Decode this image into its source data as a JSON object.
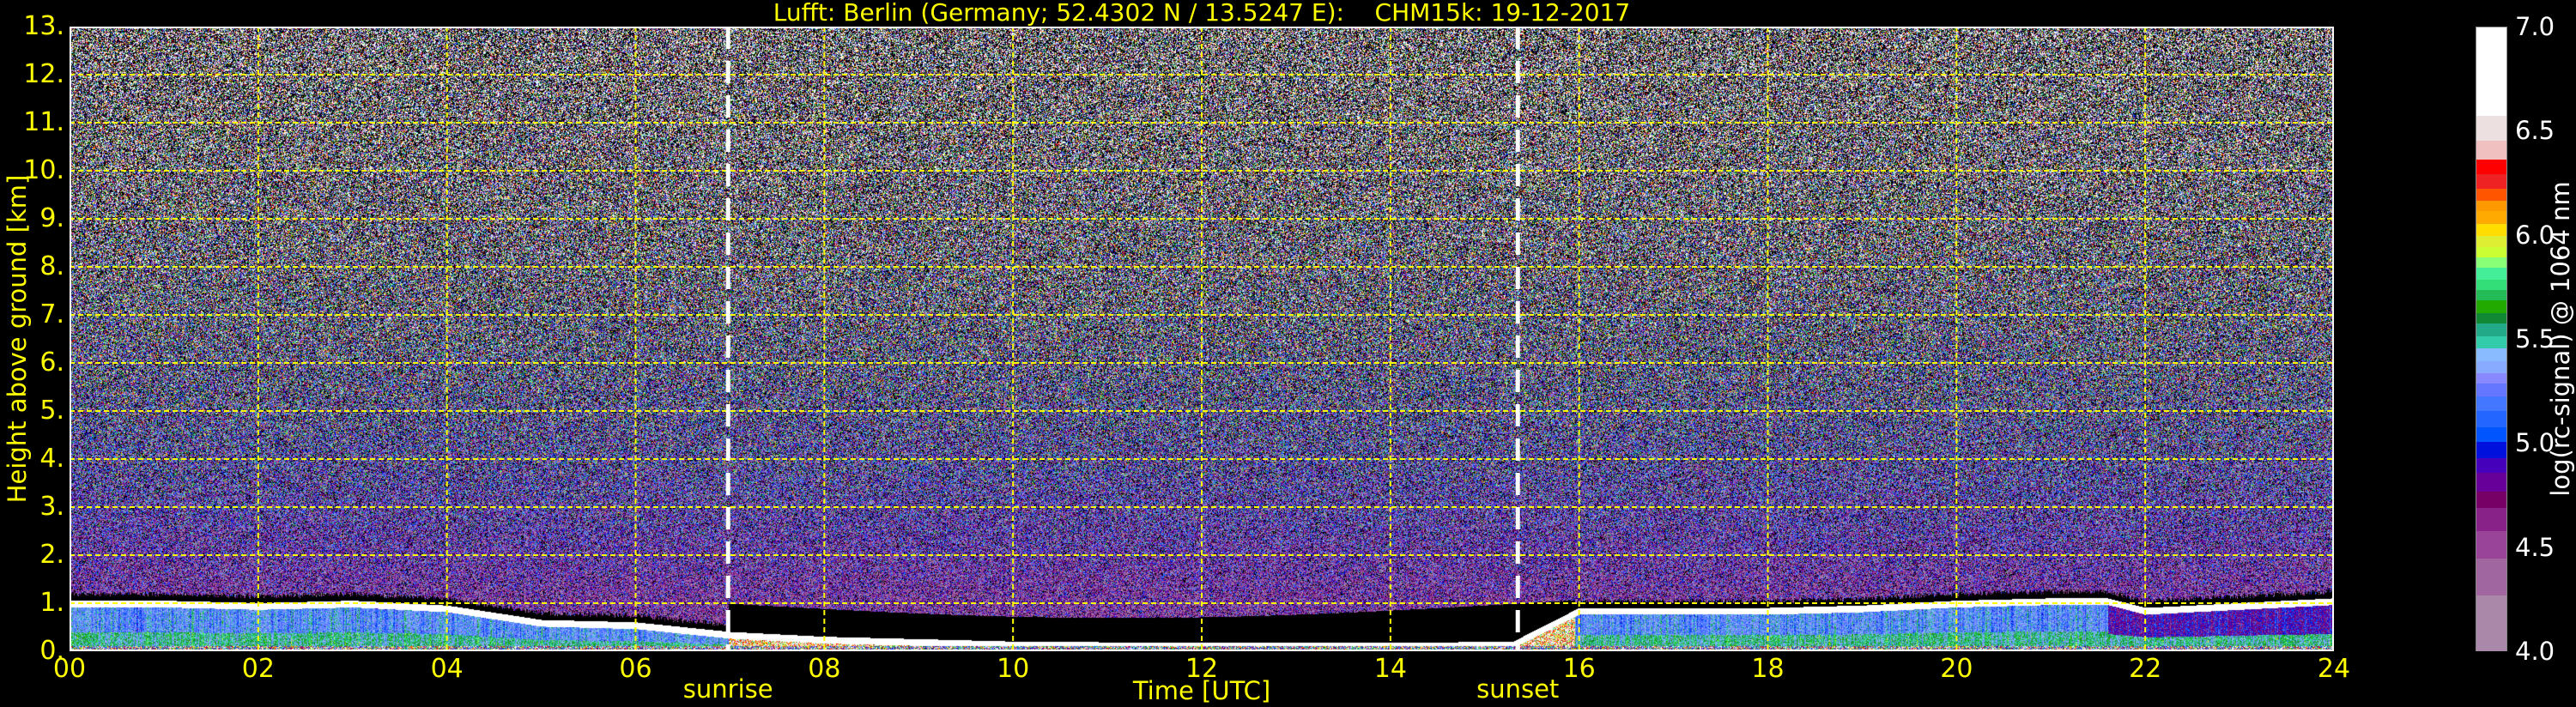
{
  "chart_data": {
    "type": "heatmap",
    "title": "Lufft: Berlin (Germany; 52.4302 N / 13.5247 E):    CHM15k: 19-12-2017",
    "xlabel": "Time [UTC]",
    "ylabel": "Height above ground [km]",
    "xlim": [
      0,
      24
    ],
    "ylim": [
      0,
      13
    ],
    "xticks": [
      0,
      2,
      4,
      6,
      8,
      10,
      12,
      14,
      16,
      18,
      20,
      22,
      24
    ],
    "xtick_labels": [
      "00",
      "02",
      "04",
      "06",
      "08",
      "10",
      "12",
      "14",
      "16",
      "18",
      "20",
      "22",
      "24"
    ],
    "yticks": [
      0,
      1,
      2,
      3,
      4,
      5,
      6,
      7,
      8,
      9,
      10,
      11,
      12,
      13
    ],
    "ytick_labels": [
      "0.",
      "1.",
      "2.",
      "3.",
      "4.",
      "5.",
      "6.",
      "7.",
      "8.",
      "9.",
      "10.",
      "11.",
      "12.",
      "13."
    ],
    "grid": true,
    "grid_color": "#ffff00",
    "annotations": [
      {
        "label": "sunrise",
        "time": 6.98
      },
      {
        "label": "sunset",
        "time": 15.35
      }
    ],
    "colorbar": {
      "label": "log(rc-signal) @ 1064 nm",
      "range": [
        4.0,
        7.0
      ],
      "ticks": [
        4.0,
        4.5,
        5.0,
        5.5,
        6.0,
        6.5,
        7.0
      ],
      "tick_labels": [
        "4.0",
        "4.5",
        "5.0",
        "5.5",
        "6.0",
        "6.5",
        "7.0"
      ],
      "levels": [
        4.0,
        4.27,
        4.45,
        4.58,
        4.69,
        4.77,
        4.86,
        4.93,
        5.01,
        5.08,
        5.16,
        5.23,
        5.29,
        5.34,
        5.4,
        5.46,
        5.52,
        5.58,
        5.63,
        5.69,
        5.74,
        5.79,
        5.85,
        5.9,
        5.95,
        6.0,
        6.06,
        6.12,
        6.17,
        6.23,
        6.3,
        6.37,
        6.46,
        6.58,
        7.0
      ],
      "colors": [
        "#aa88aa",
        "#a066a0",
        "#994499",
        "#882288",
        "#770066",
        "#660099",
        "#4400bb",
        "#0011dd",
        "#0055ff",
        "#2266ff",
        "#4477ff",
        "#6677ff",
        "#8888ff",
        "#88aaff",
        "#88bbff",
        "#33ccaa",
        "#22aa88",
        "#118833",
        "#22aa00",
        "#22bb55",
        "#33dd77",
        "#44ee99",
        "#88ff77",
        "#ccff33",
        "#ddee33",
        "#ffdd00",
        "#ffaa00",
        "#ff9900",
        "#ff5500",
        "#ee2222",
        "#ff0000",
        "#f0c0c0",
        "#ece0e0",
        "#ffffff"
      ]
    },
    "boundary_layer_top_km": {
      "time": [
        0,
        1,
        2,
        3,
        3.5,
        4,
        4.5,
        5,
        6,
        6.5,
        7,
        8,
        9,
        10,
        12,
        14,
        15.3,
        16,
        17,
        18,
        19,
        20,
        21,
        21.6,
        22,
        23,
        24
      ],
      "height": [
        1.0,
        1.0,
        0.95,
        1.0,
        0.95,
        0.9,
        0.75,
        0.6,
        0.55,
        0.45,
        0.35,
        0.25,
        0.2,
        0.15,
        0.12,
        0.12,
        0.15,
        0.85,
        0.85,
        0.85,
        0.9,
        1.0,
        1.05,
        1.05,
        0.85,
        0.95,
        1.05
      ]
    }
  }
}
